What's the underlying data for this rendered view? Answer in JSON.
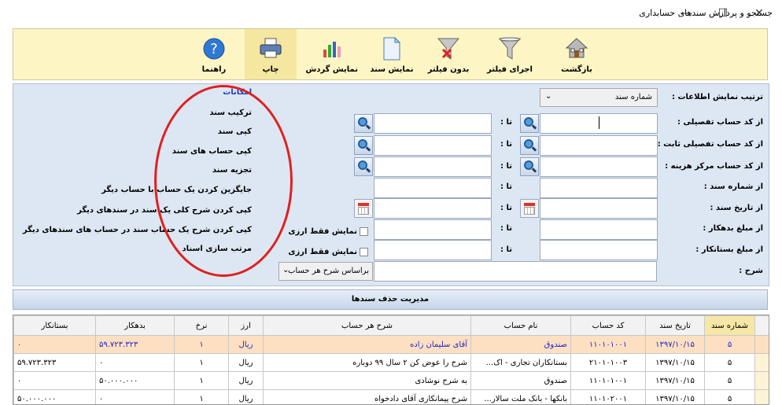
{
  "window": {
    "title": "جستجو و پردازش سندهای حسابداری",
    "controls": [
      "—",
      "☐",
      "✕"
    ]
  },
  "toolbar": {
    "buttons": [
      {
        "label": "بازگشت",
        "icon": "home-icon"
      },
      {
        "label": "اجرای فیلتر",
        "icon": "funnel-icon"
      },
      {
        "label": "بدون فیلتر",
        "icon": "funnel-clear-icon"
      },
      {
        "label": "نمایش سند",
        "icon": "document-icon"
      },
      {
        "label": "نمایش گردش",
        "icon": "chart-icon"
      },
      {
        "label": "چاپ",
        "icon": "printer-icon"
      },
      {
        "label": "راهنما",
        "icon": "help-icon"
      }
    ]
  },
  "filter": {
    "sort_label": "ترتیب نمایش اطلاعات :",
    "sort_value": "شماره سند",
    "rows": [
      {
        "label": "از کد حساب تفصیلی :",
        "to": "تا :"
      },
      {
        "label": "از کد حساب تفصیلی ثابت :",
        "to": "تا :"
      },
      {
        "label": "از کد حساب مرکز هزینه :",
        "to": "تا :"
      },
      {
        "label": "از شماره سند :",
        "to": "تا :"
      },
      {
        "label": "از تاریخ سند :",
        "to": "تا :"
      },
      {
        "label": "از مبلغ بدهکار :",
        "to": "تا :"
      },
      {
        "label": "از مبلغ بستانکار :",
        "to": "تا :"
      }
    ],
    "desc_label": "شرح :",
    "desc_mode": "براساس شرح هر حساب",
    "currency_only_1": "نمایش فقط ارزی",
    "currency_only_2": "نمایش فقط ارزی"
  },
  "options": {
    "header": "امکانات",
    "items": [
      "ترکیب سند",
      "کپی سند",
      "کپی حساب های سند",
      "تجزیه سند",
      "جایگزین کردن یک حساب با حساب دیگر",
      "کپی کردن شرح کلی یک سند در سندهای دیگر",
      "کپی کردن شرح یک حساب سند در حساب های سندهای دیگر",
      "مرتب سازی اسناد"
    ]
  },
  "manage_bar": "مدیریت حذف سندها",
  "table": {
    "columns": [
      "شماره سند",
      "تاریخ سند",
      "کد حساب",
      "نام حساب",
      "شرح هر حساب",
      "ارز",
      "نرخ",
      "بدهکار",
      "بستانکار"
    ],
    "rows": [
      [
        "۵",
        "۱۳۹۷/۱۰/۱۵",
        "۱۱۰۱۰۱۰۰۱",
        "صندوق",
        "آقای سلیمان زاده",
        "ریال",
        "۱",
        "۵۹.۷۲۳.۳۲۳",
        "۰"
      ],
      [
        "۵",
        "۱۳۹۷/۱۰/۱۵",
        "۲۱۰۱۰۱۰۰۳",
        "بستانکاران تجاری - اک...",
        "شرح را عوض کن ۲ سال ۹۹ دوباره",
        "ریال",
        "۱",
        "۰",
        "۵۹.۷۲۳.۳۲۳"
      ],
      [
        "۵",
        "۱۳۹۷/۱۰/۱۵",
        "۱۱۰۱۰۱۰۰۱",
        "صندوق",
        "به شرح نوشادی",
        "ریال",
        "۱",
        "۵۰.۰۰۰.۰۰۰",
        "۰"
      ],
      [
        "۵",
        "۱۳۹۷/۱۰/۱۵",
        "۱۱۰۱۰۲۰۰۱",
        "بانکها - بانک ملت سالار...",
        "شرح پیمانکاری آقای دادخواه",
        "ریال",
        "۱",
        "۰",
        "۵۰.۰۰۰.۰۰۰"
      ]
    ]
  },
  "colors": {
    "toolbar_bg": "#fdf6c4",
    "panel_bg": "#dde7f3",
    "highlight_row": "#fde0c2",
    "highlight_text": "#2323c9",
    "annotation": "#e02020"
  }
}
